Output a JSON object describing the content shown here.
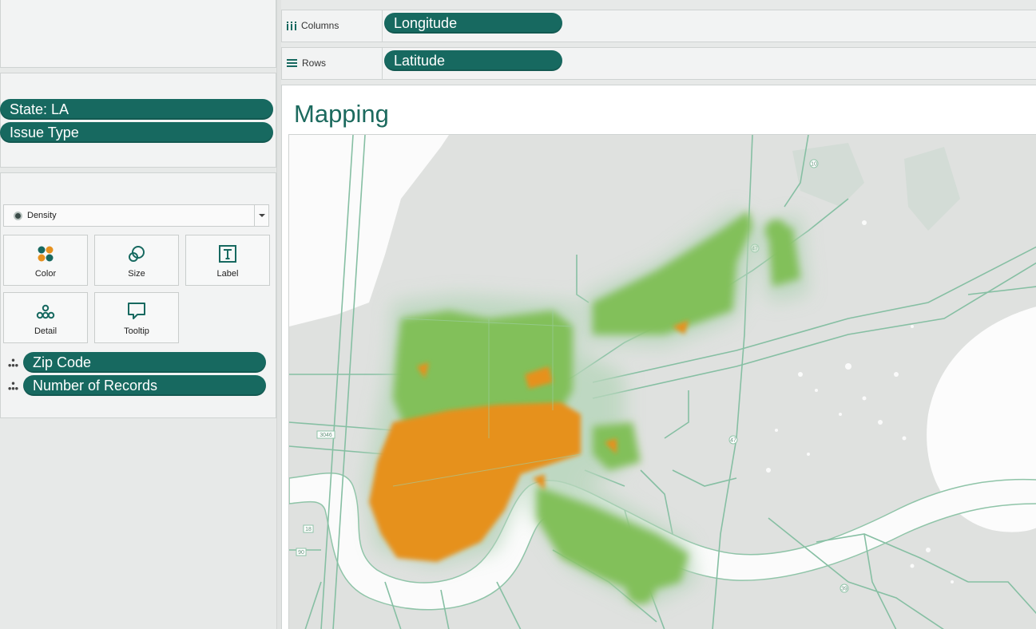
{
  "shelves": {
    "columns": {
      "label": "Columns",
      "pill": "Longitude"
    },
    "rows": {
      "label": "Rows",
      "pill": "Latitude"
    }
  },
  "filters": [
    "State: LA",
    "Issue Type"
  ],
  "marks": {
    "type_selected": "Density",
    "cards": {
      "color": "Color",
      "size": "Size",
      "label": "Label",
      "detail": "Detail",
      "tooltip": "Tooltip"
    },
    "fields": [
      "Zip Code",
      "Number of Records"
    ]
  },
  "sheet": {
    "title": "Mapping"
  },
  "map": {
    "route_shields": [
      "10",
      "47",
      "47",
      "39",
      "18",
      "90",
      "3046"
    ],
    "colors": {
      "accent": "#176960",
      "land": "#dfe1df",
      "water": "#fcfcfc",
      "road": "#86bfa3",
      "density_low": "#82c05a",
      "density_high": "#e6911f"
    }
  }
}
